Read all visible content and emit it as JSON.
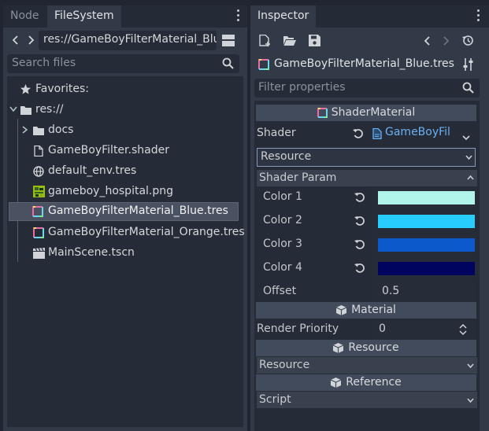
{
  "left_panel": {
    "tabs": [
      "Node",
      "FileSystem"
    ],
    "path_value": "res://GameBoyFilterMaterial_Blu",
    "search_placeholder": "Search files",
    "tree": {
      "favorites": "Favorites:",
      "root": "res://",
      "items": [
        {
          "label": "docs",
          "icon": "folder-icon"
        },
        {
          "label": "GameBoyFilter.shader",
          "icon": "file-icon"
        },
        {
          "label": "default_env.tres",
          "icon": "globe-icon"
        },
        {
          "label": "gameboy_hospital.png",
          "icon": "image-icon"
        },
        {
          "label": "GameBoyFilterMaterial_Blue.tres",
          "icon": "material-icon"
        },
        {
          "label": "GameBoyFilterMaterial_Orange.tres",
          "icon": "material-icon"
        },
        {
          "label": "MainScene.tscn",
          "icon": "scene-icon"
        }
      ]
    }
  },
  "right_panel": {
    "tab": "Inspector",
    "resource_name": "GameBoyFilterMaterial_Blue.tres",
    "filter_placeholder": "Filter properties",
    "shader_material_header": "ShaderMaterial",
    "shader_label": "Shader",
    "shader_value": "GameBoyFil",
    "resource_dropdown": "Resource",
    "shader_param_header": "Shader Param",
    "params": [
      {
        "label": "Color 1",
        "color": "#b1f4ea"
      },
      {
        "label": "Color 2",
        "color": "#27cdfd"
      },
      {
        "label": "Color 3",
        "color": "#0b59cb"
      },
      {
        "label": "Color 4",
        "color": "#00045f"
      }
    ],
    "offset_label": "Offset",
    "offset_value": "0.5",
    "material_header": "Material",
    "render_priority_label": "Render Priority",
    "render_priority_value": "0",
    "resource_header": "Resource",
    "resource_value": "Resource",
    "reference_header": "Reference",
    "reference_value": "Script"
  }
}
